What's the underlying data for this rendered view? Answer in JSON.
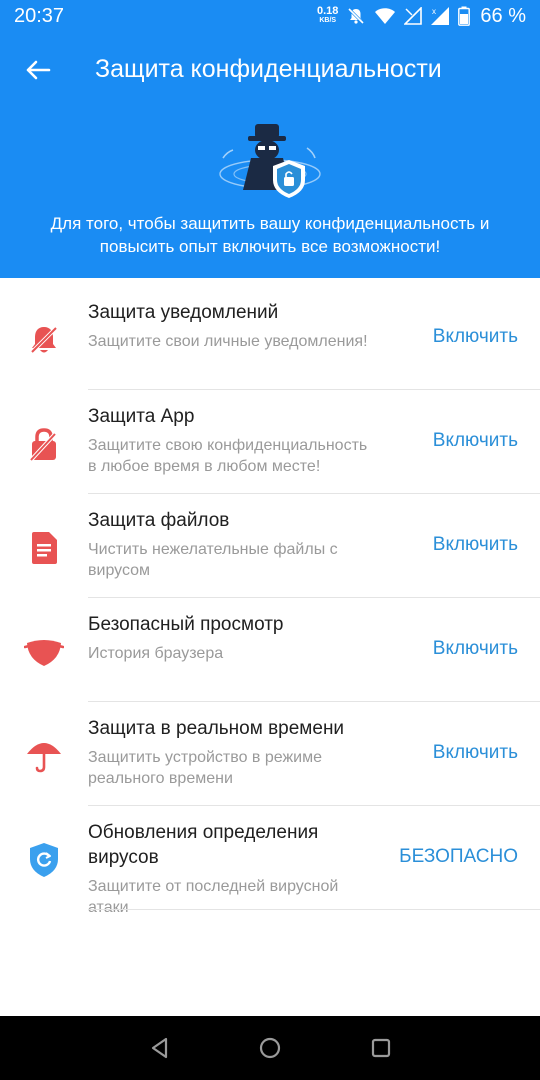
{
  "status_bar": {
    "time": "20:37",
    "net_speed_value": "0.18",
    "net_speed_unit": "KB/S",
    "battery": "66 %",
    "icons": [
      "mute-icon",
      "wifi-icon",
      "signal-icon",
      "signal-icon"
    ]
  },
  "toolbar": {
    "back_icon": "arrow-left-icon",
    "title": "Защита конфиденциальности"
  },
  "header": {
    "illustration": "spy-shield-icon",
    "description": "Для того, чтобы защитить вашу конфиденциальность и повысить опыт включить все возможности!"
  },
  "items": [
    {
      "icon": "bell-off-icon",
      "title": "Защита уведомлений",
      "subtitle": "Защитите свои личные уведомления!",
      "action": "Включить"
    },
    {
      "icon": "lock-icon",
      "title": "Защита App",
      "subtitle": "Защитите свою конфиденциальность в любое время в любом месте!",
      "action": "Включить"
    },
    {
      "icon": "file-icon",
      "title": "Защита файлов",
      "subtitle": "Чистить нежелательные файлы с вирусом",
      "action": "Включить"
    },
    {
      "icon": "mask-icon",
      "title": "Безопасный просмотр",
      "subtitle": "История браузера",
      "action": "Включить"
    },
    {
      "icon": "umbrella-icon",
      "title": "Защита в реальном времени",
      "subtitle": "Защитить устройство в режиме реального времени",
      "action": "Включить"
    },
    {
      "icon": "shield-refresh-icon",
      "title": "Обновления определения вирусов",
      "subtitle": "Защитите от последней вирусной атаки",
      "action": "БЕЗОПАСНО"
    }
  ],
  "colors": {
    "header_bg": "#1a8cf3",
    "action_text": "#2b8fd8",
    "icon_red": "#e85353",
    "icon_blue": "#3aa0ee"
  },
  "navigation_bar": {
    "buttons": [
      "back-triangle-icon",
      "home-circle-icon",
      "recents-square-icon"
    ]
  }
}
